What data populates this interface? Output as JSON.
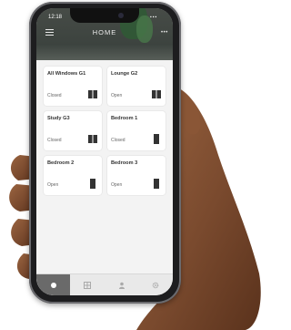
{
  "status_bar": {
    "time": "12:18",
    "icons": "▪▪▪"
  },
  "header": {
    "title": "HOME"
  },
  "cards": [
    {
      "name": "All Windows G1",
      "state": "Closed",
      "icon": "double-window-icon"
    },
    {
      "name": "Lounge G2",
      "state": "Open",
      "icon": "double-window-icon"
    },
    {
      "name": "Study G3",
      "state": "Closed",
      "icon": "double-window-icon"
    },
    {
      "name": "Bedroom 1",
      "state": "Closed",
      "icon": "single-window-icon"
    },
    {
      "name": "Bedroom 2",
      "state": "Open",
      "icon": "single-window-icon"
    },
    {
      "name": "Bedroom 3",
      "state": "Open",
      "icon": "single-window-icon"
    }
  ],
  "tabs": [
    {
      "icon": "home-icon",
      "active": true
    },
    {
      "icon": "grid-icon",
      "active": false
    },
    {
      "icon": "people-icon",
      "active": false
    },
    {
      "icon": "gear-icon",
      "active": false
    }
  ],
  "colors": {
    "header_bg": "#3a3f3a",
    "screen_bg": "#f3f3f3",
    "active_tab": "#6a6a6a",
    "skin": "#7a4a2e"
  }
}
